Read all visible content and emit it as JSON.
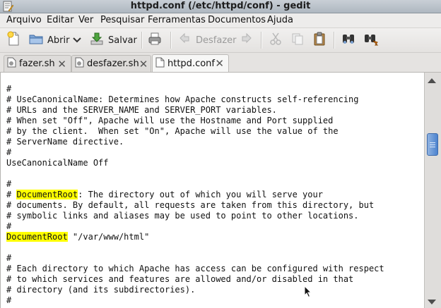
{
  "window": {
    "title": "httpd.conf (/etc/httpd/conf) - gedit"
  },
  "menubar": {
    "items": [
      "Arquivo",
      "Editar",
      "Ver",
      "Pesquisar",
      "Ferramentas",
      "Documentos",
      "Ajuda"
    ]
  },
  "toolbar": {
    "new_icon": "new-document-icon",
    "open_label": "Abrir",
    "save_label": "Salvar",
    "undo_label": "Desfazer",
    "undo_enabled": false,
    "redo_enabled": false,
    "cut_enabled": false,
    "copy_enabled": false
  },
  "tabs": [
    {
      "label": "fazer.sh",
      "active": false
    },
    {
      "label": "desfazer.sh",
      "active": false
    },
    {
      "label": "httpd.conf",
      "active": true
    }
  ],
  "editor": {
    "highlight_color": "#ffff00",
    "lines": [
      {
        "segments": [
          {
            "text": "#"
          }
        ]
      },
      {
        "segments": [
          {
            "text": "# UseCanonicalName: Determines how Apache constructs self-referencing"
          }
        ]
      },
      {
        "segments": [
          {
            "text": "# URLs and the SERVER_NAME and SERVER_PORT variables."
          }
        ]
      },
      {
        "segments": [
          {
            "text": "# When set \"Off\", Apache will use the Hostname and Port supplied"
          }
        ]
      },
      {
        "segments": [
          {
            "text": "# by the client.  When set \"On\", Apache will use the value of the"
          }
        ]
      },
      {
        "segments": [
          {
            "text": "# ServerName directive."
          }
        ]
      },
      {
        "segments": [
          {
            "text": "#"
          }
        ]
      },
      {
        "segments": [
          {
            "text": "UseCanonicalName Off"
          }
        ]
      },
      {
        "segments": [
          {
            "text": ""
          }
        ]
      },
      {
        "segments": [
          {
            "text": "#"
          }
        ]
      },
      {
        "segments": [
          {
            "text": "# "
          },
          {
            "text": "DocumentRoot",
            "highlight": true
          },
          {
            "text": ": The directory out of which you will serve your"
          }
        ]
      },
      {
        "segments": [
          {
            "text": "# documents. By default, all requests are taken from this directory, but"
          }
        ]
      },
      {
        "segments": [
          {
            "text": "# symbolic links and aliases may be used to point to other locations."
          }
        ]
      },
      {
        "segments": [
          {
            "text": "#"
          }
        ]
      },
      {
        "segments": [
          {
            "text": "DocumentRoot",
            "highlight": true
          },
          {
            "text": " \"/var/www/html\""
          }
        ]
      },
      {
        "segments": [
          {
            "text": ""
          }
        ]
      },
      {
        "segments": [
          {
            "text": "#"
          }
        ]
      },
      {
        "segments": [
          {
            "text": "# Each directory to which Apache has access can be configured with respect"
          }
        ]
      },
      {
        "segments": [
          {
            "text": "# to which services and features are allowed and/or disabled in that"
          }
        ]
      },
      {
        "segments": [
          {
            "text": "# directory (and its subdirectories)."
          }
        ]
      },
      {
        "segments": [
          {
            "text": "#"
          }
        ]
      }
    ]
  },
  "scrollbar": {
    "position_fraction": 0.3
  }
}
